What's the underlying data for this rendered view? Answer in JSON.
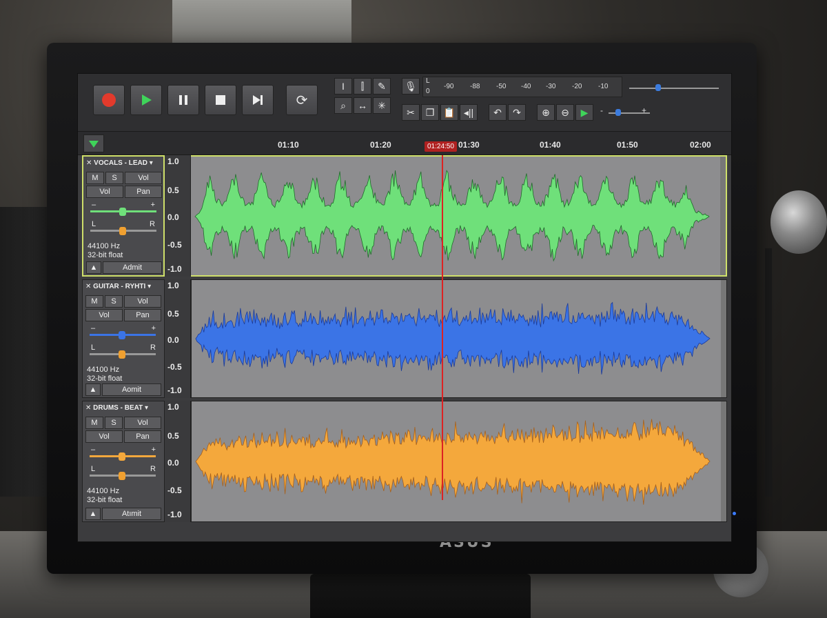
{
  "app": {
    "brand": "ASUS",
    "colors": {
      "vocals": "#6fe07a",
      "guitar": "#3b74e6",
      "drums": "#f4a83c",
      "playhead": "#d22222",
      "selected_border": "#cfe06a"
    }
  },
  "toolbar": {
    "record_icon": "record-icon",
    "play_icon": "play-icon",
    "pause_icon": "pause-icon",
    "stop_icon": "stop-icon",
    "skip_end_icon": "skip-end-icon",
    "loop_icon": "loop-icon",
    "meter_top": {
      "channel": "L",
      "ticks": [
        "-90",
        "-88",
        "-50",
        "-40",
        "-30",
        "-20",
        "-10"
      ]
    },
    "meter_bottom": {
      "channel": "0"
    },
    "volume": {
      "minus": "-",
      "plus": "+"
    }
  },
  "timeline": {
    "ticks": [
      "01:10",
      "01:20",
      "01:30",
      "01:40",
      "01:50",
      "02:00"
    ],
    "playhead": "01:24:50"
  },
  "tracks": [
    {
      "name": "VOCALS - LEAD",
      "mute": "M",
      "solo": "S",
      "vol": "Vol",
      "vol2": "Vol",
      "pan": "Pan",
      "gain_minus": "–",
      "gain_plus": "+",
      "pan_l": "L",
      "pan_r": "R",
      "rate": "44100 Hz",
      "format": "32-bit float",
      "button": "Admit",
      "scale": [
        "1.0",
        "0.5",
        "0.0",
        "-0.5",
        "-1.0"
      ]
    },
    {
      "name": "GUITAR - RYHTI",
      "mute": "M",
      "solo": "S",
      "vol": "Vol",
      "vol2": "Vol",
      "pan": "Pan",
      "gain_minus": "–",
      "gain_plus": "+",
      "pan_l": "L",
      "pan_r": "R",
      "rate": "44100 Hz",
      "format": "32-bit float",
      "button": "Aomit",
      "scale": [
        "1.0",
        "0.5",
        "0.0",
        "-0.5",
        "-1.0"
      ]
    },
    {
      "name": "DRUMS - BEAT",
      "mute": "M",
      "solo": "S",
      "vol": "Vol",
      "vol2": "Vol",
      "pan": "Pan",
      "gain_minus": "–",
      "gain_plus": "+",
      "pan_l": "L",
      "pan_r": "R",
      "rate": "44100 Hz",
      "format": "32-bit float",
      "button": "Atımit",
      "scale": [
        "1.0",
        "0.5",
        "0.0",
        "-0.5",
        "-1.0"
      ]
    }
  ]
}
